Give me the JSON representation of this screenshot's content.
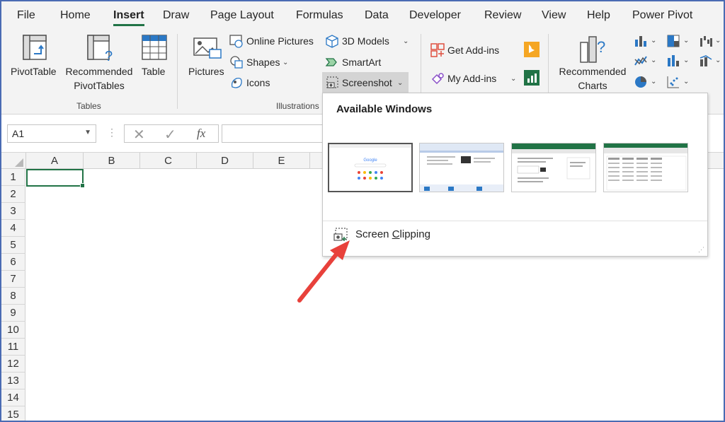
{
  "tabs": [
    "File",
    "Home",
    "Insert",
    "Draw",
    "Page Layout",
    "Formulas",
    "Data",
    "Developer",
    "Review",
    "View",
    "Help",
    "Power Pivot"
  ],
  "active_tab": "Insert",
  "ribbon": {
    "tables": {
      "pivot": "PivotTable",
      "rec1": "Recommended",
      "rec2": "PivotTables",
      "table": "Table",
      "group": "Tables"
    },
    "illustrations": {
      "pictures": "Pictures",
      "online": "Online Pictures",
      "shapes": "Shapes",
      "icons": "Icons",
      "models": "3D Models",
      "smartart": "SmartArt",
      "screenshot": "Screenshot",
      "group": "Illustrations"
    },
    "addins": {
      "get": "Get Add-ins",
      "my": "My Add-ins"
    },
    "charts": {
      "rec1": "Recommended",
      "rec2": "Charts"
    }
  },
  "formula_bar": {
    "name_box": "A1",
    "fx": "fx"
  },
  "columns": [
    "A",
    "B",
    "C",
    "D",
    "E"
  ],
  "rows": [
    "1",
    "2",
    "3",
    "4",
    "5",
    "6",
    "7",
    "8",
    "9",
    "10",
    "11",
    "12",
    "13",
    "14",
    "15"
  ],
  "dropdown": {
    "title": "Available Windows",
    "clip_pre": "Screen ",
    "clip_u": "C",
    "clip_post": "lipping",
    "thumb_text": "Google"
  },
  "colors": {
    "accent": "#217346",
    "arrow": "#e8413b",
    "frame": "#4a6bb3"
  }
}
